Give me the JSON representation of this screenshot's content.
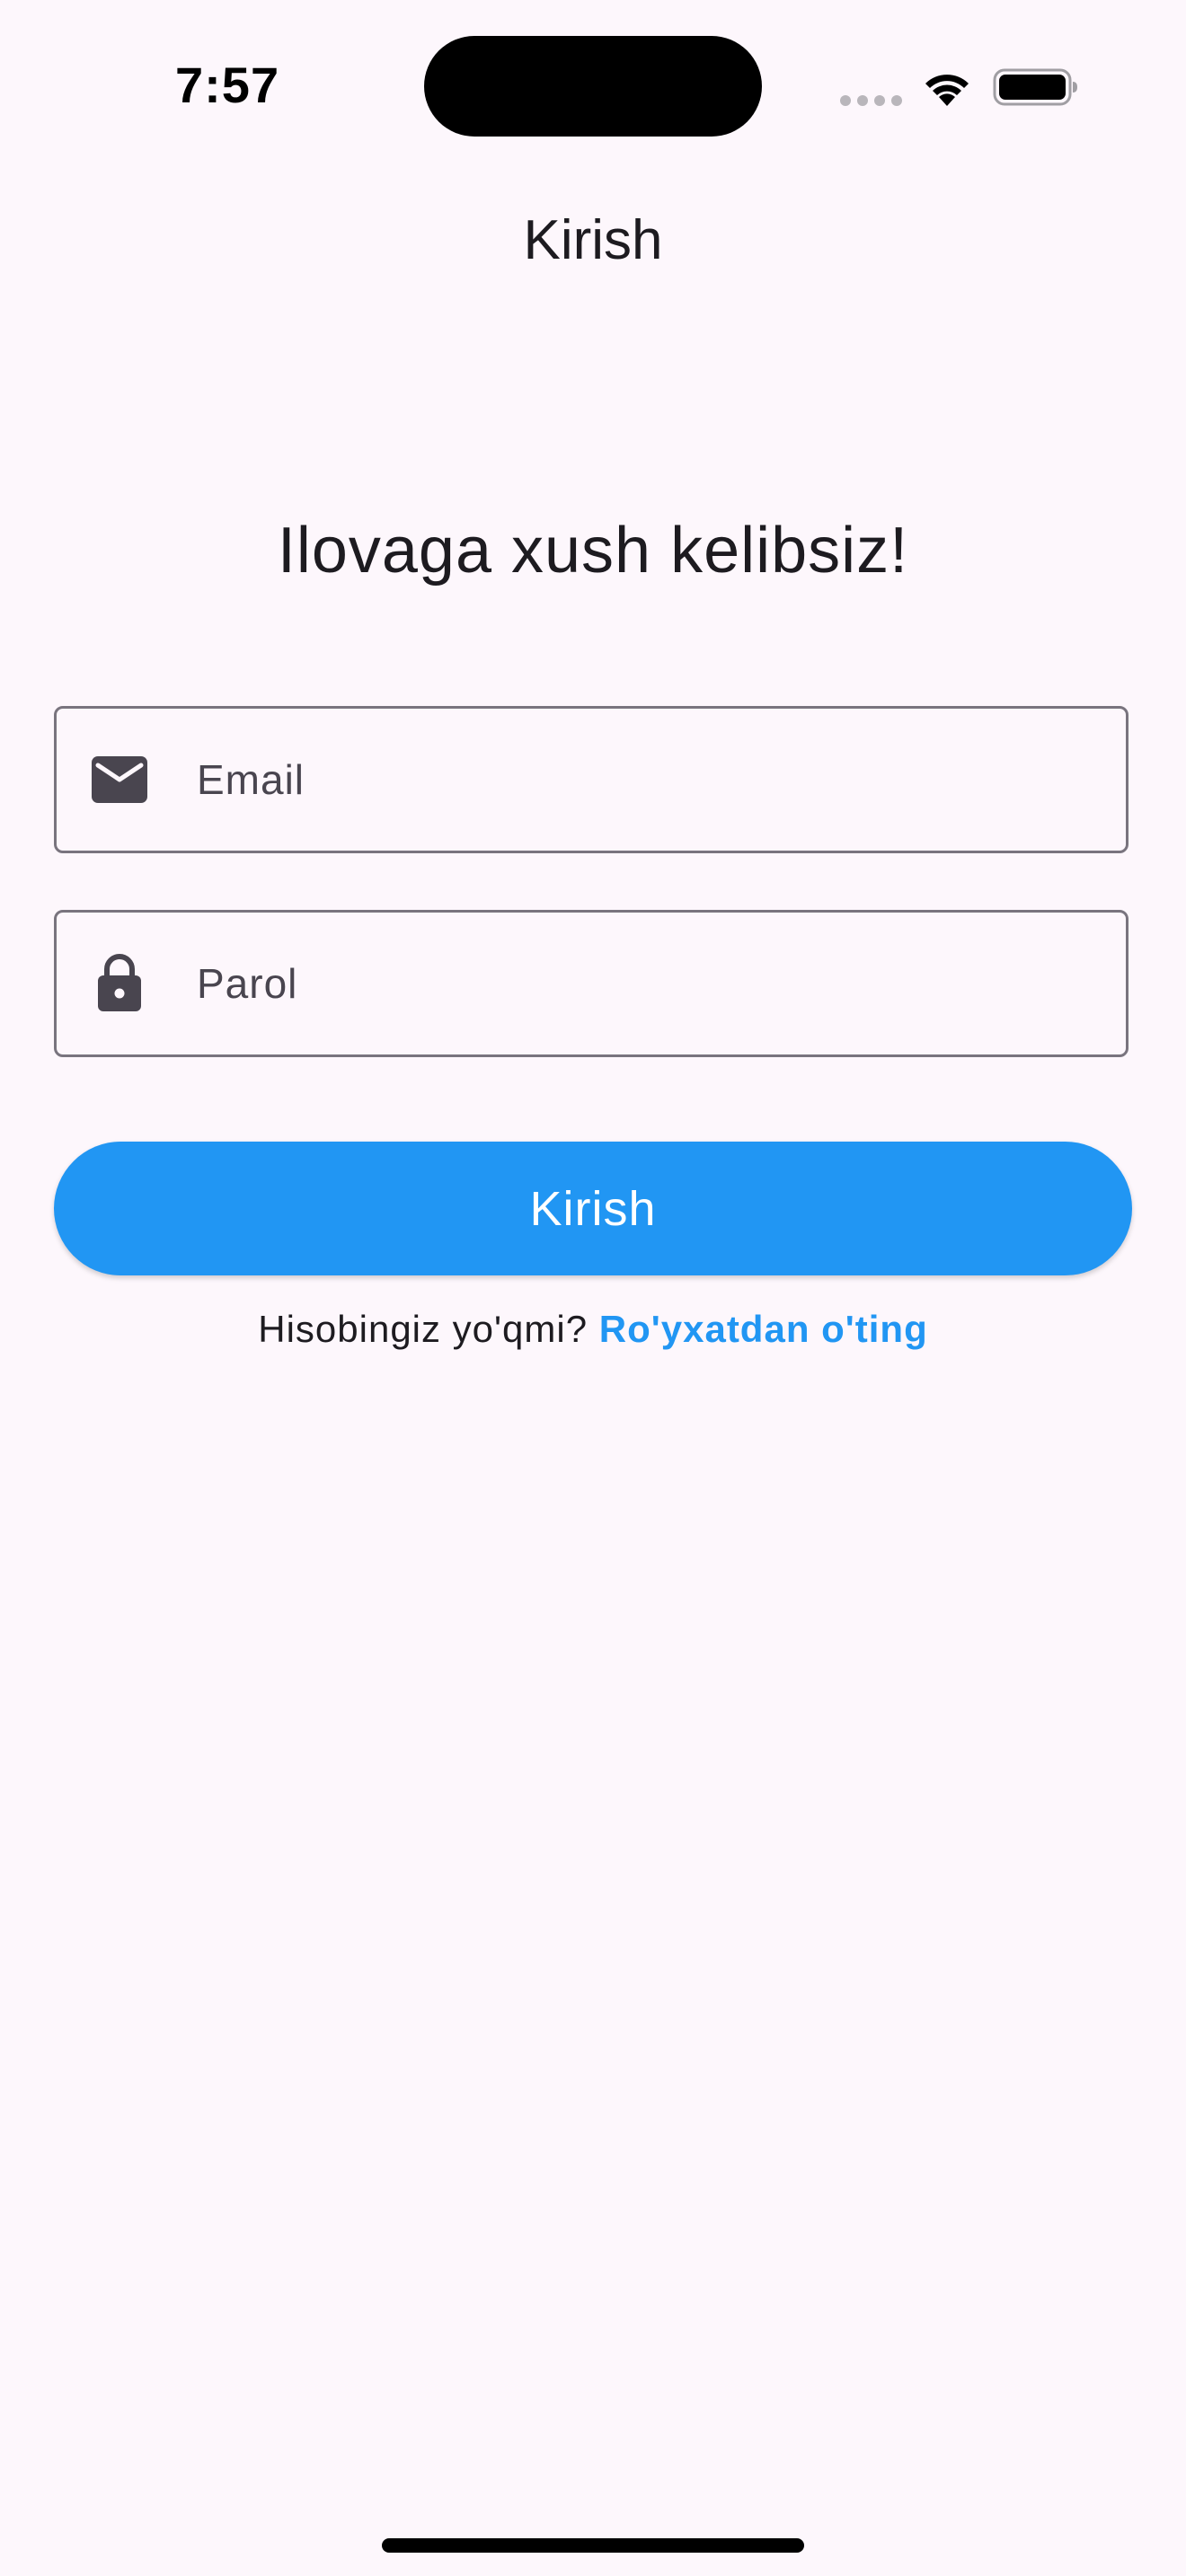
{
  "status_bar": {
    "time": "7:57"
  },
  "app_bar": {
    "title": "Kirish"
  },
  "welcome": {
    "heading": "Ilovaga xush kelibsiz!"
  },
  "form": {
    "email": {
      "placeholder": "Email",
      "value": "",
      "icon": "mail-icon"
    },
    "password": {
      "placeholder": "Parol",
      "value": "",
      "icon": "lock-icon"
    },
    "submit_label": "Kirish"
  },
  "register": {
    "prompt": "Hisobingiz yo'qmi?",
    "link_label": "Ro'yxatdan o'ting"
  },
  "colors": {
    "background": "#fdf7fc",
    "accent": "#2196f3",
    "outline": "#79747e",
    "icon": "#49454f"
  }
}
